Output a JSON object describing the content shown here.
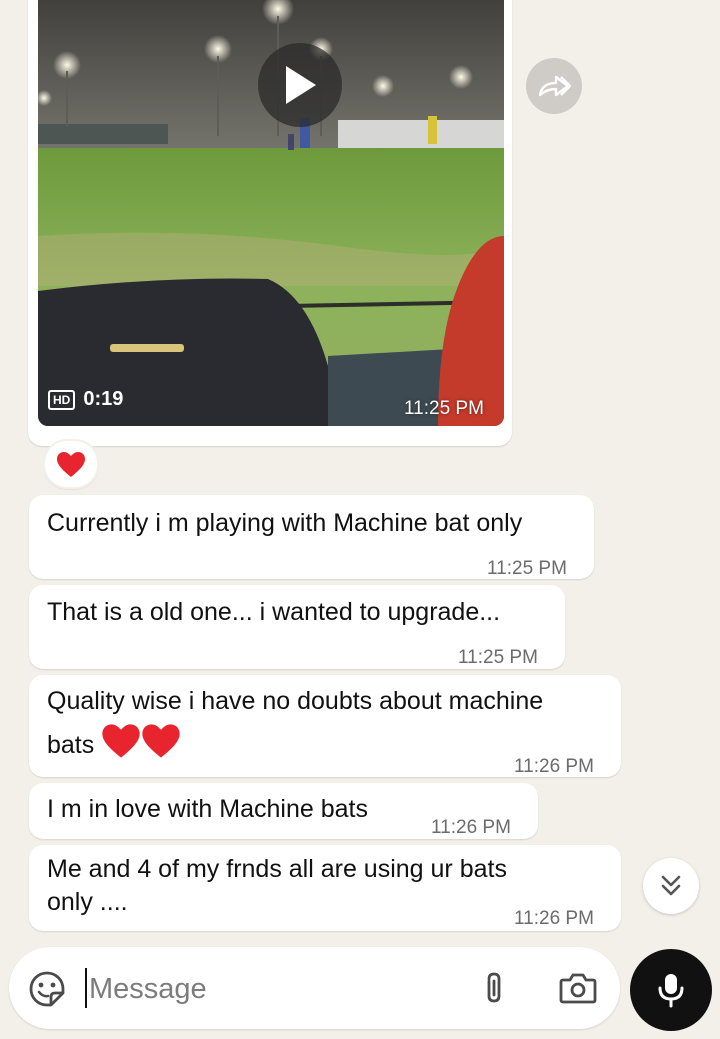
{
  "video_message": {
    "quality_badge": "HD",
    "duration": "0:19",
    "time": "11:25 PM",
    "reaction": "heart"
  },
  "messages": [
    {
      "text": "Currently i m playing with Machine bat only",
      "time": "11:25 PM"
    },
    {
      "text": "That is a old one... i wanted to upgrade...",
      "time": "11:25 PM"
    },
    {
      "text": "Quality wise i have no doubts about machine",
      "text_line2": "bats",
      "time": "11:26 PM"
    },
    {
      "text": "I m in love with Machine bats",
      "time": "11:26 PM"
    },
    {
      "text": "Me and 4 of my frnds all are using ur bats",
      "text_line2": "only ....",
      "time": "11:26 PM"
    }
  ],
  "composer": {
    "placeholder": "Message"
  },
  "colors": {
    "chat_background": "#f3efe9",
    "bubble": "#ffffff",
    "timestamp": "#6b6b6b",
    "mic_button": "#111111"
  },
  "icons": [
    "play-icon",
    "forward-icon",
    "heart-icon",
    "scroll-down-icon",
    "sticker-icon",
    "attach-icon",
    "camera-icon",
    "mic-icon"
  ]
}
